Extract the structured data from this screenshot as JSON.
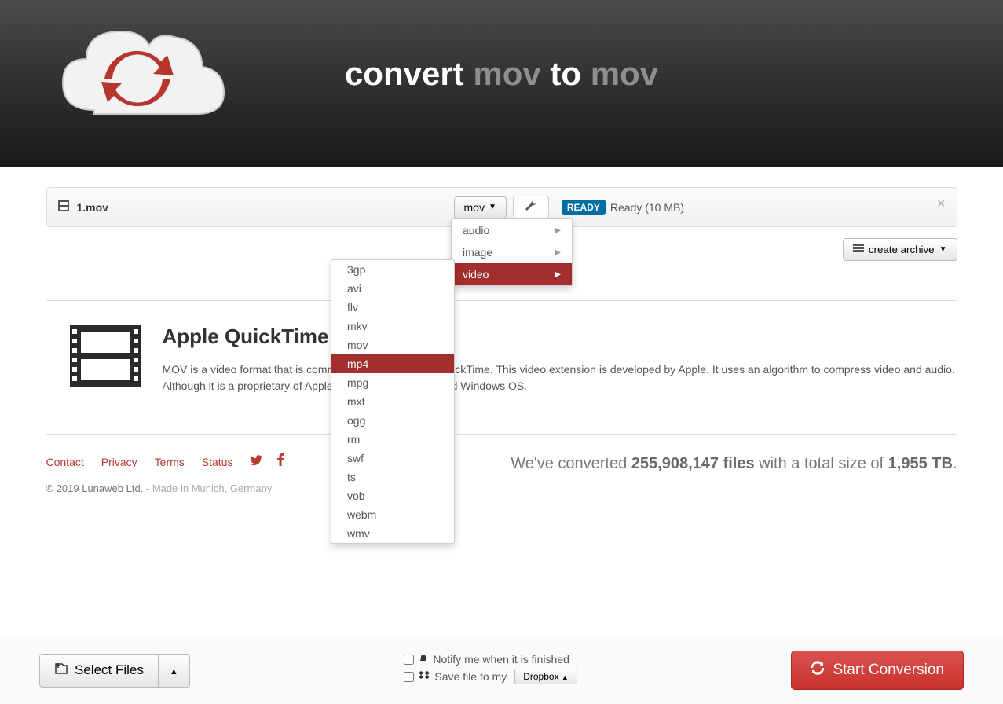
{
  "header": {
    "title_prefix": "convert ",
    "from_format": "mov",
    "title_mid": " to ",
    "to_format": "mov"
  },
  "file": {
    "name": "1.mov",
    "dropdown_label": "mov",
    "status_badge": "READY",
    "status_text": "Ready (10 MB)"
  },
  "archive_button": "create archive",
  "info": {
    "heading": "Apple QuickTime",
    "body": "MOV is a video format that is commonly associated with QuickTime. This video extension is developed by Apple. It uses an algorithm to compress video and audio. Although it is a proprietary of Apple, it runs on both MAC and Windows OS."
  },
  "categories": [
    {
      "label": "audio",
      "active": false
    },
    {
      "label": "image",
      "active": false
    },
    {
      "label": "video",
      "active": true
    }
  ],
  "formats": [
    "3gp",
    "avi",
    "flv",
    "mkv",
    "mov",
    "mp4",
    "mpg",
    "mxf",
    "ogg",
    "rm",
    "swf",
    "ts",
    "vob",
    "webm",
    "wmv"
  ],
  "highlighted_format": "mp4",
  "footer": {
    "links": [
      "Contact",
      "Privacy",
      "Terms",
      "Status"
    ],
    "copyright": "© 2019 Lunaweb Ltd.",
    "made_in": " - Made in Munich, Germany",
    "stats_prefix": "We've converted ",
    "stats_count": "255,908,147 files",
    "stats_mid": " with a total size of ",
    "stats_size": "1,955 TB",
    "stats_suffix": "."
  },
  "bottom": {
    "select_files": "Select Files",
    "notify": "Notify me when it is finished",
    "save_to": "Save file to my",
    "dropbox": "Dropbox",
    "start": "Start Conversion"
  }
}
